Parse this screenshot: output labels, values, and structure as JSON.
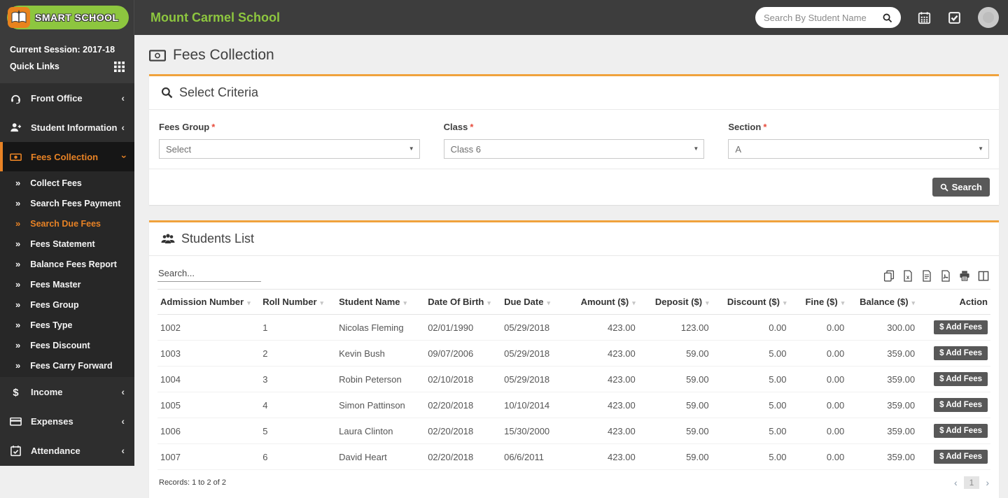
{
  "colors": {
    "accent_orange": "#f0a23c",
    "brand_green": "#8dc63f",
    "sidebar_active_orange": "#e78225"
  },
  "topbar": {
    "logo_text": "SMART SCHOOL",
    "school_name": "Mount Carmel School",
    "search_placeholder": "Search By Student Name",
    "icons": [
      "calendar-icon",
      "tasks-icon",
      "avatar"
    ]
  },
  "sidebar": {
    "session_label": "Current Session: 2017-18",
    "quick_links_label": "Quick Links",
    "menu_top": [
      {
        "label": "Front Office",
        "icon": "headset",
        "chevron": "left"
      },
      {
        "label": "Student Information",
        "icon": "user-plus",
        "chevron": "left"
      }
    ],
    "menu_active": {
      "label": "Fees Collection",
      "icon": "money",
      "chevron": "down"
    },
    "submenu": [
      {
        "label": "Collect Fees",
        "active": false
      },
      {
        "label": "Search Fees Payment",
        "active": false
      },
      {
        "label": "Search Due Fees",
        "active": true
      },
      {
        "label": "Fees Statement",
        "active": false
      },
      {
        "label": "Balance Fees Report",
        "active": false
      },
      {
        "label": "Fees Master",
        "active": false
      },
      {
        "label": "Fees Group",
        "active": false
      },
      {
        "label": "Fees Type",
        "active": false
      },
      {
        "label": "Fees Discount",
        "active": false
      },
      {
        "label": "Fees Carry Forward",
        "active": false
      }
    ],
    "menu_bottom": [
      {
        "label": "Income",
        "icon": "dollar",
        "chevron": "left"
      },
      {
        "label": "Expenses",
        "icon": "credit-card",
        "chevron": "left"
      },
      {
        "label": "Attendance",
        "icon": "calendar-check",
        "chevron": "left"
      }
    ]
  },
  "page": {
    "title": "Fees Collection"
  },
  "criteria": {
    "title": "Select Criteria",
    "fields": [
      {
        "label": "Fees Group",
        "required": true,
        "value": "Select"
      },
      {
        "label": "Class",
        "required": true,
        "value": "Class 6"
      },
      {
        "label": "Section",
        "required": true,
        "value": "A"
      }
    ],
    "search_button": "Search"
  },
  "students": {
    "title": "Students List",
    "search_placeholder": "Search...",
    "export_icons": [
      "copy",
      "excel",
      "file",
      "pdf",
      "print",
      "columns"
    ],
    "columns": [
      {
        "label": "Admission Number",
        "sortable": true
      },
      {
        "label": "Roll Number",
        "sortable": true
      },
      {
        "label": "Student Name",
        "sortable": true
      },
      {
        "label": "Date Of Birth",
        "sortable": true
      },
      {
        "label": "Due Date",
        "sortable": true
      },
      {
        "label": "Amount ($)",
        "sortable": true
      },
      {
        "label": "Deposit ($)",
        "sortable": true
      },
      {
        "label": "Discount ($)",
        "sortable": true
      },
      {
        "label": "Fine ($)",
        "sortable": true
      },
      {
        "label": "Balance ($)",
        "sortable": true
      },
      {
        "label": "Action",
        "sortable": false
      }
    ],
    "action_label": "$ Add Fees",
    "rows": [
      [
        "1002",
        "1",
        "Nicolas Fleming",
        "02/01/1990",
        "05/29/2018",
        "423.00",
        "123.00",
        "0.00",
        "0.00",
        "300.00"
      ],
      [
        "1003",
        "2",
        "Kevin Bush",
        "09/07/2006",
        "05/29/2018",
        "423.00",
        "59.00",
        "5.00",
        "0.00",
        "359.00"
      ],
      [
        "1004",
        "3",
        "Robin Peterson",
        "02/10/2018",
        "05/29/2018",
        "423.00",
        "59.00",
        "5.00",
        "0.00",
        "359.00"
      ],
      [
        "1005",
        "4",
        "Simon Pattinson",
        "02/20/2018",
        "10/10/2014",
        "423.00",
        "59.00",
        "5.00",
        "0.00",
        "359.00"
      ],
      [
        "1006",
        "5",
        "Laura Clinton",
        "02/20/2018",
        "15/30/2000",
        "423.00",
        "59.00",
        "5.00",
        "0.00",
        "359.00"
      ],
      [
        "1007",
        "6",
        "David Heart",
        "02/20/2018",
        "06/6/2011",
        "423.00",
        "59.00",
        "5.00",
        "0.00",
        "359.00"
      ]
    ],
    "records_text": "Records: 1 to 2 of 2",
    "pagination": {
      "prev": "‹",
      "page": "1",
      "next": "›"
    }
  }
}
